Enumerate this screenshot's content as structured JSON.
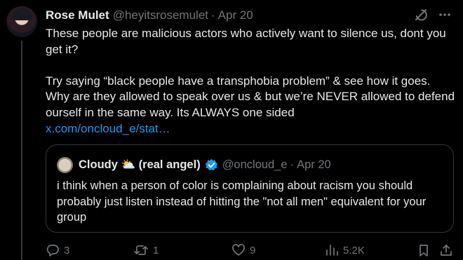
{
  "author": {
    "name": "Rose Mulet",
    "handle": "@heyitsrosemulet",
    "separator": "·",
    "date": "Apr 20"
  },
  "post": {
    "lines": [
      "These people are malicious actors who actively want to silence us, dont you get it?",
      "Try saying “black people have a transphobia problem” & see how it goes. Why are they allowed to speak over us & but we’re NEVER allowed to defend ourself in the same way. Its ALWAYS one sided"
    ],
    "link": "x.com/oncloud_e/stat…"
  },
  "quote": {
    "name_prefix": "Cloudy",
    "emoji": "⛅",
    "name_suffix": "(real angel)",
    "handle": "@oncloud_e",
    "separator": "·",
    "date": "Apr 20",
    "text": "i think when a person of color is complaining about racism you should probably just listen instead of hitting the \"not all men\" equivalent for your group"
  },
  "actions": {
    "replies": "3",
    "reposts": "1",
    "likes": "9",
    "views": "5.2K"
  },
  "colors": {
    "background": "#000000",
    "text": "#e7e9ea",
    "muted": "#71767b",
    "link": "#1d9bf0",
    "border": "#333639",
    "verified": "#1d9bf0"
  },
  "icons": [
    "grok-icon",
    "more-icon",
    "verified-badge-icon",
    "reply-icon",
    "repost-icon",
    "like-icon",
    "views-icon",
    "bookmark-icon",
    "share-icon"
  ]
}
